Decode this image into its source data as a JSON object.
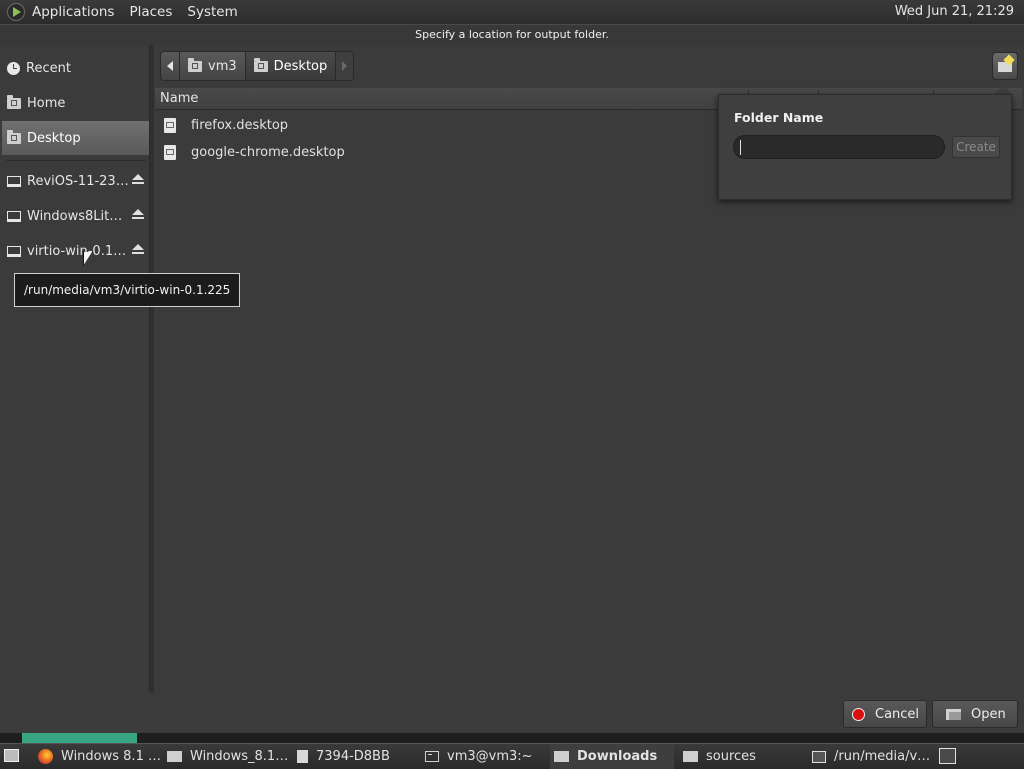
{
  "top_panel": {
    "menus": [
      "Applications",
      "Places",
      "System"
    ],
    "clock": "Wed Jun 21, 21:29"
  },
  "dialog": {
    "title": "Specify a location for output folder."
  },
  "sidebar": {
    "items": [
      {
        "label": "Recent",
        "icon": "recent-clock-icon"
      },
      {
        "label": "Home",
        "icon": "home-folder-icon"
      },
      {
        "label": "Desktop",
        "icon": "desktop-folder-icon",
        "selected": true
      },
      {
        "label": "ReviOS-11-23…",
        "icon": "drive-icon",
        "eject": true
      },
      {
        "label": "Windows8Lit…",
        "icon": "drive-icon",
        "eject": true
      },
      {
        "label": "virtio-win-0.1…",
        "icon": "drive-icon",
        "eject": true
      }
    ]
  },
  "pathbar": {
    "segments": [
      "vm3",
      "Desktop"
    ],
    "active": "Desktop"
  },
  "filelist": {
    "column_name": "Name",
    "files": [
      "firefox.desktop",
      "google-chrome.desktop"
    ]
  },
  "popover": {
    "label": "Folder Name",
    "input_value": "",
    "create_label": "Create"
  },
  "tooltip": {
    "text": "/run/media/vm3/virtio-win-0.1.225"
  },
  "buttons": {
    "cancel": "Cancel",
    "open": "Open"
  },
  "taskbar": {
    "items": [
      {
        "label": "Windows 8.1 …",
        "icon": "firefox-icon"
      },
      {
        "label": "Windows_8.1…",
        "icon": "folder-icon"
      },
      {
        "label": "7394-D8BB",
        "icon": "folder-icon"
      },
      {
        "label": "vm3@vm3:~",
        "icon": "terminal-icon"
      },
      {
        "label": "Downloads",
        "icon": "folder-icon",
        "active": true
      },
      {
        "label": "sources",
        "icon": "folder-icon"
      },
      {
        "label": "/run/media/v…",
        "icon": "app-window-icon"
      }
    ]
  },
  "colors": {
    "background": "#3b3b3b",
    "selected": "#646464",
    "cancel_red": "#d80f0f",
    "new_folder_star": "#f2dc5a"
  }
}
